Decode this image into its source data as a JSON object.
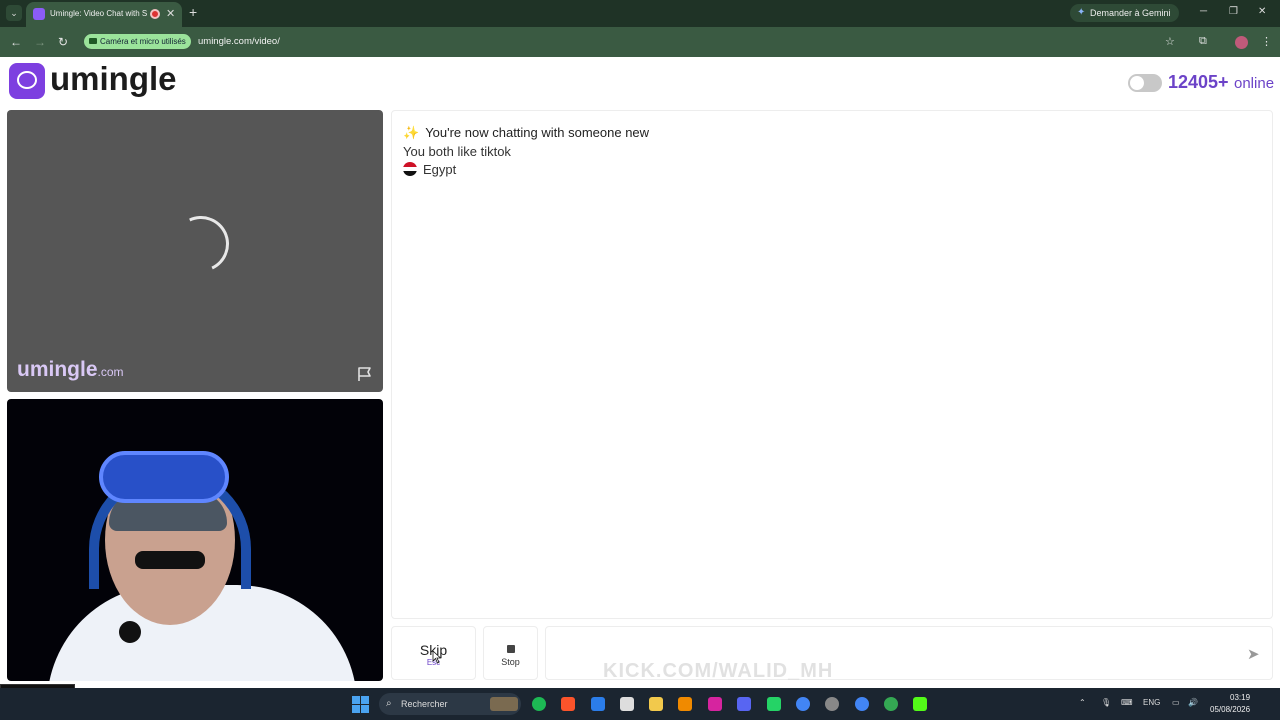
{
  "browser": {
    "tab_title": "Umingle: Video Chat with S",
    "close_tab": "✕",
    "new_tab": "+",
    "gemini_label": "Demander à Gemini",
    "permission_chip": "Caméra et micro utilisés",
    "url": "umingle.com/video/"
  },
  "header": {
    "logo_text": "umingle",
    "online_count": "12405+",
    "online_label": "online",
    "brand_color": "#6c43c8"
  },
  "stranger_video": {
    "watermark": "umingle",
    "watermark_suffix": ".com"
  },
  "chat": {
    "line1": "You're now chatting with someone new",
    "line2": "You both like tiktok",
    "country": "Egypt",
    "input_placeholder": ""
  },
  "controls": {
    "skip_label": "Skip",
    "skip_hint": "Esc",
    "stop_label": "Stop"
  },
  "overlay": {
    "kick_text": "KICK.COM/WALID_MH"
  },
  "taskbar": {
    "search_label": "Rechercher",
    "lang": "ENG",
    "time": "03:19",
    "date": "05/08/2026"
  }
}
